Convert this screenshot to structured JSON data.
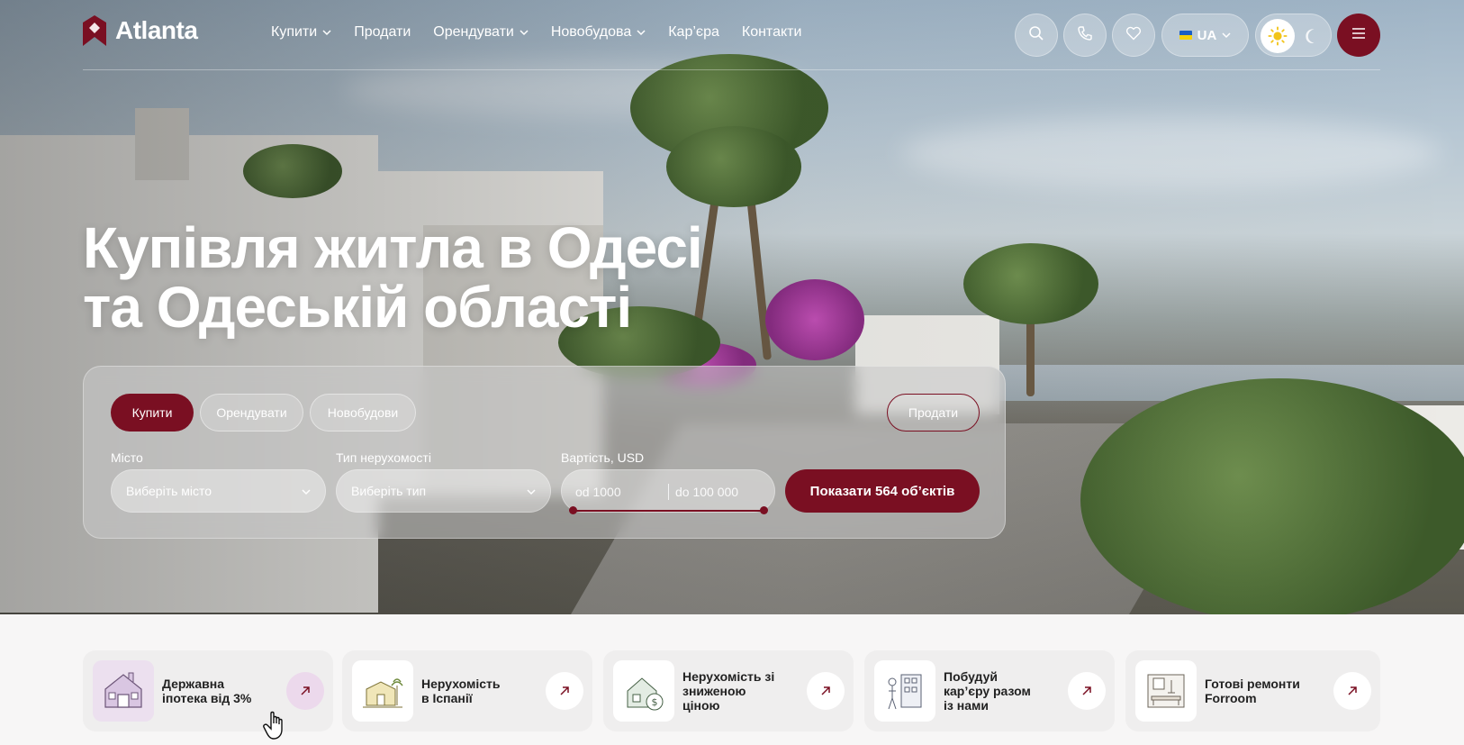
{
  "brand": {
    "name": "Atlanta",
    "accent": "#7a0f22"
  },
  "nav": {
    "items": [
      {
        "label": "Купити",
        "has_dropdown": true
      },
      {
        "label": "Продати",
        "has_dropdown": false
      },
      {
        "label": "Орендувати",
        "has_dropdown": true
      },
      {
        "label": "Новобудова",
        "has_dropdown": true
      },
      {
        "label": "Кар’єра",
        "has_dropdown": false
      },
      {
        "label": "Контакти",
        "has_dropdown": false
      }
    ]
  },
  "header_actions": {
    "search_icon": "search-icon",
    "phone_icon": "phone-icon",
    "favorites_icon": "heart-icon",
    "language": {
      "code": "UA",
      "flag": "ukraine-flag"
    },
    "theme": {
      "active": "light",
      "light_icon": "sun-icon",
      "dark_icon": "moon-icon"
    },
    "menu_icon": "hamburger-icon"
  },
  "hero": {
    "headline_line1": "Купівля житла в Одесі",
    "headline_line2": "та Одеській області"
  },
  "search": {
    "tabs": [
      {
        "label": "Купити",
        "active": true
      },
      {
        "label": "Орендувати",
        "active": false
      },
      {
        "label": "Новобудови",
        "active": false
      }
    ],
    "sell_button": "Продати",
    "city": {
      "label": "Місто",
      "placeholder": "Виберіть місто"
    },
    "type": {
      "label": "Тип нерухомості",
      "placeholder": "Виберіть тип"
    },
    "price": {
      "label": "Вартість, USD",
      "from_placeholder": "od 1000",
      "to_placeholder": "do 100 000"
    },
    "submit": "Показати 564 об’єктів"
  },
  "cards": [
    {
      "title_line1": "Державна",
      "title_line2": "іпотека від 3%",
      "highlighted": true,
      "icon": "house-icon"
    },
    {
      "title_line1": "Нерухомість",
      "title_line2": "в Іспанії",
      "highlighted": false,
      "icon": "villa-icon"
    },
    {
      "title_line1": "Нерухомість зі",
      "title_line2": "зниженою",
      "title_line3": "ціною",
      "highlighted": false,
      "icon": "discount-house-icon"
    },
    {
      "title_line1": "Побудуй",
      "title_line2": "кар’єру разом",
      "title_line3": "із нами",
      "highlighted": false,
      "icon": "career-icon"
    },
    {
      "title_line1": "Готові ремонти",
      "title_line2": "Forroom",
      "highlighted": false,
      "icon": "interior-icon"
    }
  ]
}
